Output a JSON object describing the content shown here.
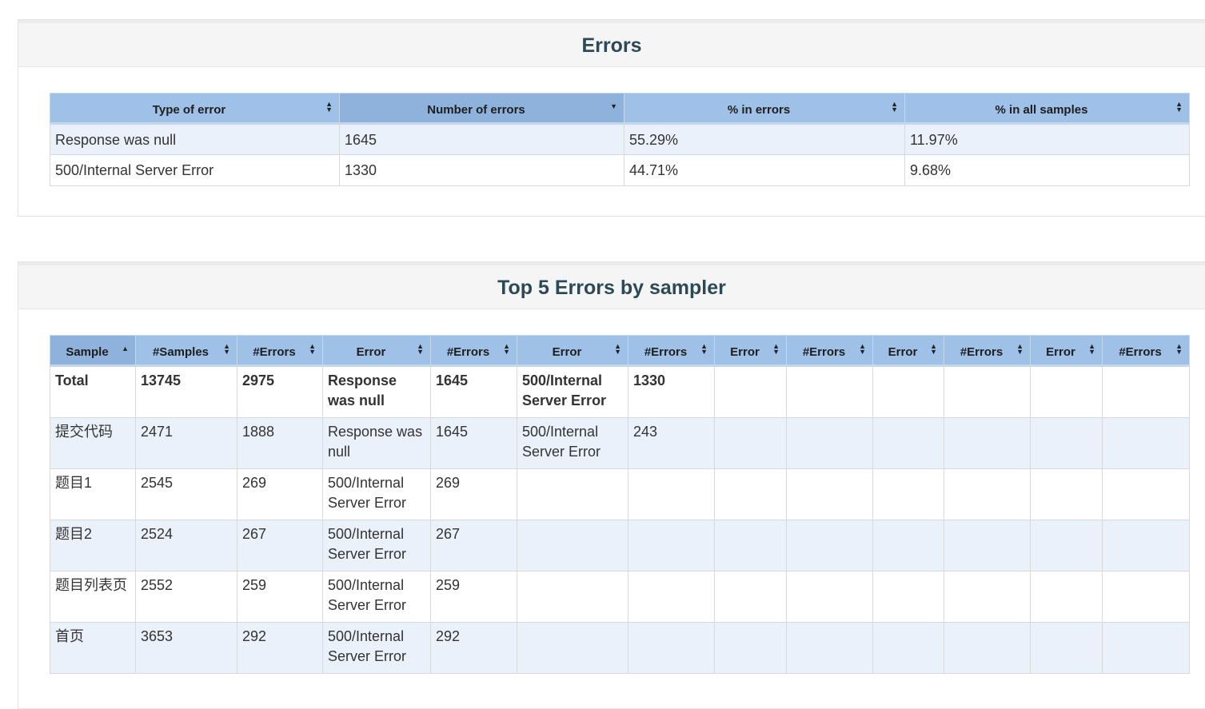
{
  "errors": {
    "title": "Errors",
    "columns": [
      "Type of error",
      "Number of errors",
      "% in errors",
      "% in all samples"
    ],
    "rows": [
      [
        "Response was null",
        "1645",
        "55.29%",
        "11.97%"
      ],
      [
        "500/Internal Server Error",
        "1330",
        "44.71%",
        "9.68%"
      ]
    ]
  },
  "top5": {
    "title": "Top 5 Errors by sampler",
    "columns": [
      "Sample",
      "#Samples",
      "#Errors",
      "Error",
      "#Errors",
      "Error",
      "#Errors",
      "Error",
      "#Errors",
      "Error",
      "#Errors",
      "Error",
      "#Errors"
    ],
    "total": [
      "Total",
      "13745",
      "2975",
      "Response was null",
      "1645",
      "500/Internal Server Error",
      "1330",
      "",
      "",
      "",
      "",
      "",
      ""
    ],
    "rows": [
      [
        "提交代码",
        "2471",
        "1888",
        "Response was null",
        "1645",
        "500/Internal Server Error",
        "243",
        "",
        "",
        "",
        "",
        "",
        ""
      ],
      [
        "题目1",
        "2545",
        "269",
        "500/Internal Server Error",
        "269",
        "",
        "",
        "",
        "",
        "",
        "",
        "",
        ""
      ],
      [
        "题目2",
        "2524",
        "267",
        "500/Internal Server Error",
        "267",
        "",
        "",
        "",
        "",
        "",
        "",
        "",
        ""
      ],
      [
        "题目列表页",
        "2552",
        "259",
        "500/Internal Server Error",
        "259",
        "",
        "",
        "",
        "",
        "",
        "",
        "",
        ""
      ],
      [
        "首页",
        "3653",
        "292",
        "500/Internal Server Error",
        "292",
        "",
        "",
        "",
        "",
        "",
        "",
        "",
        ""
      ]
    ]
  }
}
